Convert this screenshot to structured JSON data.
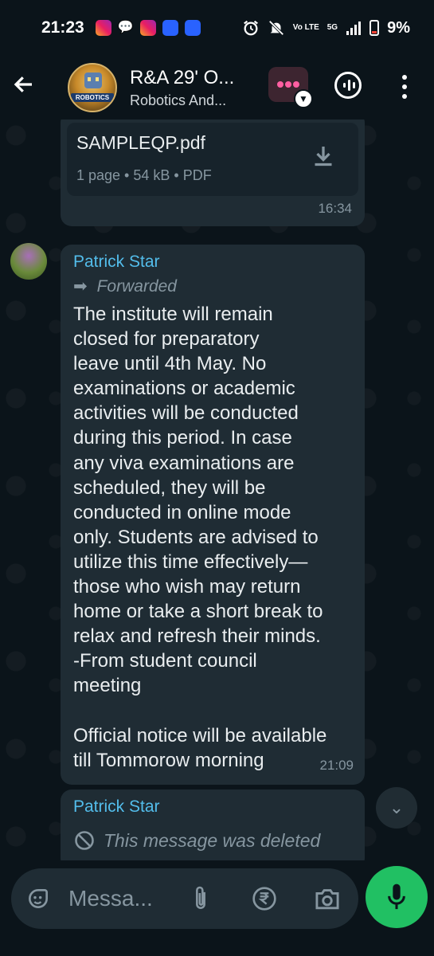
{
  "status_bar": {
    "time": "21:23",
    "network_label": "Vo LTE",
    "signal_label": "5G",
    "battery": "9%",
    "notification_icons": [
      "instagram-icon",
      "chat-icon",
      "instagram-icon",
      "phone-app-icon",
      "phone-app-icon"
    ],
    "status_icons": [
      "alarm-icon",
      "mute-icon",
      "signal-icon",
      "battery-icon"
    ]
  },
  "header": {
    "group_name": "R&A 29' O...",
    "group_subtitle": "Robotics And...",
    "avatar_badge": "ROBOTICS"
  },
  "messages": {
    "document": {
      "file_name": "SAMPLEQP.pdf",
      "meta": "1 page • 54 kB • PDF",
      "time": "16:34"
    },
    "forwarded": {
      "sender": "Patrick Star",
      "forwarded_label": "Forwarded",
      "text": "The institute will remain\nclosed for preparatory\nleave until 4th May. No\nexaminations or academic\nactivities will be conducted\nduring this period. In case\nany viva examinations are\nscheduled, they will be\nconducted in online mode\nonly. Students are advised to\nutilize this time effectively—\nthose who wish may return\nhome or take a short break to\nrelax and refresh their minds.\n-From student council\nmeeting\n\nOfficial notice will be available\ntill Tommorow morning",
      "time": "21:09"
    },
    "deleted": {
      "sender": "Patrick Star",
      "text": "This message was deleted"
    }
  },
  "input": {
    "placeholder": "Messa..."
  },
  "colors": {
    "background": "#0b141a",
    "bubble": "#1f2c34",
    "sender_name": "#53bdeb",
    "mic_button": "#21c063"
  }
}
